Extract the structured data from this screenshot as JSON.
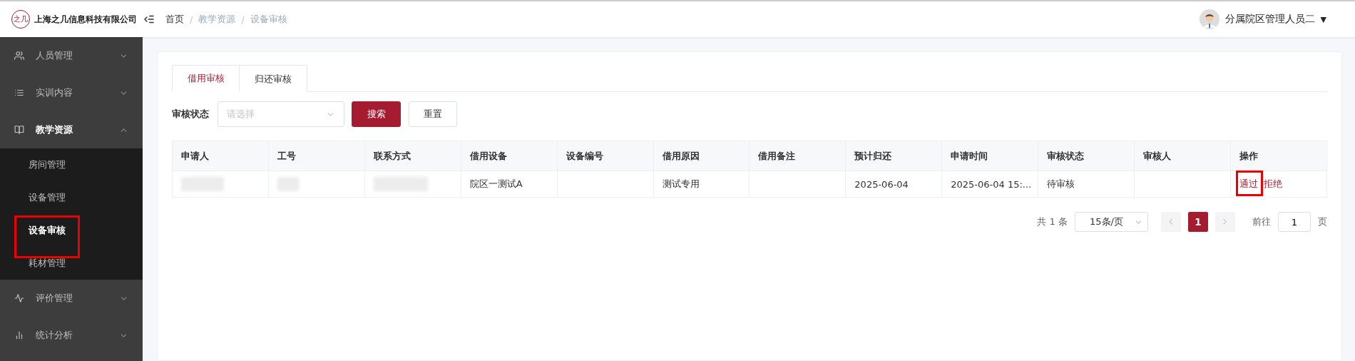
{
  "header": {
    "logo_text": "之几",
    "company": "上海之几信息科技有限公司",
    "breadcrumb_separator": "/",
    "breadcrumb": [
      {
        "label": "首页",
        "current": false
      },
      {
        "label": "教学资源",
        "current": true
      },
      {
        "label": "设备审核",
        "current": true
      }
    ],
    "user": "分属院区管理人员二",
    "user_caret": "▼"
  },
  "sidebar": {
    "items": [
      {
        "label": "人员管理",
        "expanded": false
      },
      {
        "label": "实训内容",
        "expanded": false
      },
      {
        "label": "教学资源",
        "expanded": true,
        "children": [
          {
            "label": "房间管理",
            "selected": false,
            "highlighted": false
          },
          {
            "label": "设备管理",
            "selected": false,
            "highlighted": false
          },
          {
            "label": "设备审核",
            "selected": true,
            "highlighted": true
          },
          {
            "label": "耗材管理",
            "selected": false,
            "highlighted": false
          }
        ]
      },
      {
        "label": "评价管理",
        "expanded": false
      },
      {
        "label": "统计分析",
        "expanded": false
      }
    ]
  },
  "tabs": [
    {
      "label": "借用审核",
      "selected": true
    },
    {
      "label": "归还审核",
      "selected": false
    }
  ],
  "filter": {
    "label": "审核状态",
    "placeholder": "请选择",
    "buttons": [
      {
        "label": "搜索",
        "kind": "primary"
      },
      {
        "label": "重置",
        "kind": "default"
      }
    ]
  },
  "table": {
    "columns": [
      "申请人",
      "工号",
      "联系方式",
      "借用设备",
      "设备编号",
      "借用原因",
      "借用备注",
      "预计归还",
      "申请时间",
      "审核状态",
      "审核人",
      "操作"
    ],
    "rows": [
      {
        "cells": [
          {
            "kind": "redacted"
          },
          {
            "kind": "redacted"
          },
          {
            "kind": "redacted"
          },
          {
            "kind": "text",
            "text": "院区一测试A"
          },
          {
            "kind": "empty"
          },
          {
            "kind": "text",
            "text": "测试专用"
          },
          {
            "kind": "empty"
          },
          {
            "kind": "text",
            "text": "2025-06-04"
          },
          {
            "kind": "text",
            "text": "2025-06-04 15:..."
          },
          {
            "kind": "text",
            "text": "待审核"
          },
          {
            "kind": "empty"
          },
          {
            "kind": "actions",
            "actions": [
              {
                "label": "通过",
                "highlighted": true
              },
              {
                "label": "拒绝",
                "highlighted": false
              }
            ]
          }
        ]
      }
    ]
  },
  "pagination": {
    "total": "共 1 条",
    "page_size": "15条/页",
    "pages": [
      {
        "label": "1",
        "selected": true
      }
    ],
    "goto_label": "前往",
    "goto_value": "1",
    "goto_suffix": "页"
  }
}
